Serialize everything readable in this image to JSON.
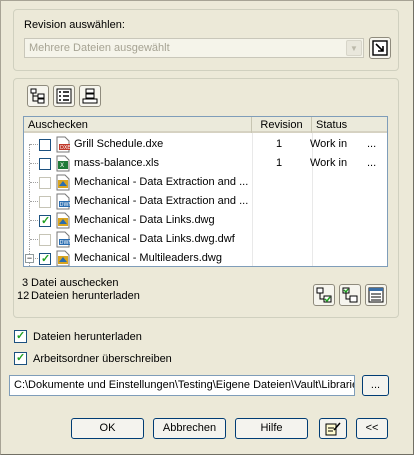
{
  "revision": {
    "label": "Revision auswählen:",
    "combo_value": "Mehrere Dateien ausgewählt"
  },
  "table": {
    "headers": {
      "name": "Auschecken",
      "revision": "Revision",
      "status": "Status"
    },
    "rows": [
      {
        "name": "Grill Schedule.dxe",
        "revision": "1",
        "status": "Work in",
        "more": "...",
        "checked": false,
        "icon": "dxe-file-icon"
      },
      {
        "name": "mass-balance.xls",
        "revision": "1",
        "status": "Work in",
        "more": "...",
        "checked": false,
        "icon": "excel-file-icon"
      },
      {
        "name": "Mechanical - Data Extraction and ...",
        "revision": "",
        "status": "",
        "more": "",
        "checked": false,
        "icon": "dwg-file-icon"
      },
      {
        "name": "Mechanical - Data Extraction and ...",
        "revision": "",
        "status": "",
        "more": "",
        "checked": false,
        "icon": "dwf-file-icon"
      },
      {
        "name": "Mechanical - Data Links.dwg",
        "revision": "",
        "status": "",
        "more": "",
        "checked": true,
        "icon": "dwg-file-icon"
      },
      {
        "name": "Mechanical - Data Links.dwg.dwf",
        "revision": "",
        "status": "",
        "more": "",
        "checked": false,
        "icon": "dwf-file-icon"
      },
      {
        "name": "Mechanical - Multileaders.dwg",
        "revision": "",
        "status": "",
        "more": "",
        "checked": true,
        "icon": "dwg-file-icon"
      }
    ]
  },
  "summary": {
    "checkout_count": "3",
    "checkout_label": "Datei auschecken",
    "download_count": "12",
    "download_label": "Dateien herunterladen"
  },
  "options": {
    "download_files": "Dateien herunterladen",
    "overwrite_workfolder": "Arbeitsordner überschreiben"
  },
  "path": {
    "value": "C:\\Dokumente und Einstellungen\\Testing\\Eigene Dateien\\Vault\\Librarie",
    "browse_label": "..."
  },
  "buttons": {
    "ok": "OK",
    "cancel": "Abbrechen",
    "help": "Hilfe",
    "collapse": "<<"
  },
  "colors": {
    "accent": "#003c74",
    "check": "#21a121",
    "dialog_bg": "#ece9d8"
  }
}
